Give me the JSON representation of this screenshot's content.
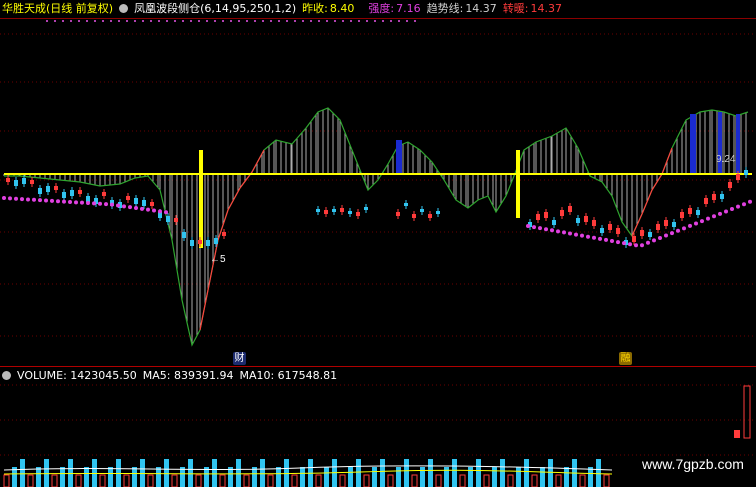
{
  "header": {
    "stock_name": "华胜天成(日线 前复权)",
    "indicator_name": "凤凰波段侧仓(6,14,95,250,1,2)",
    "prev_close_label": "昨收:",
    "prev_close_value": "8.40",
    "strength_label": "强度:",
    "strength_value": "7.16",
    "trend_label": "趋势线:",
    "trend_value": "14.37",
    "turn_label": "转暖:",
    "turn_value": "14.37"
  },
  "price_labels": {
    "low_marker": "←5",
    "high_marker": "9.24"
  },
  "badges": {
    "first": "财",
    "second": "融"
  },
  "volume_header": {
    "volume": "VOLUME: 1423045.50",
    "ma5": "MA5: 839391.94",
    "ma10": "MA10: 617548.81"
  },
  "watermark": "www.7gpzb.com",
  "colors": {
    "up": "#ff3b3b",
    "down": "#31c4f0",
    "yellow": "#ffff00",
    "magenta": "#e040e0",
    "green_line": "#2fa52f",
    "red_line": "#ff4040"
  }
}
